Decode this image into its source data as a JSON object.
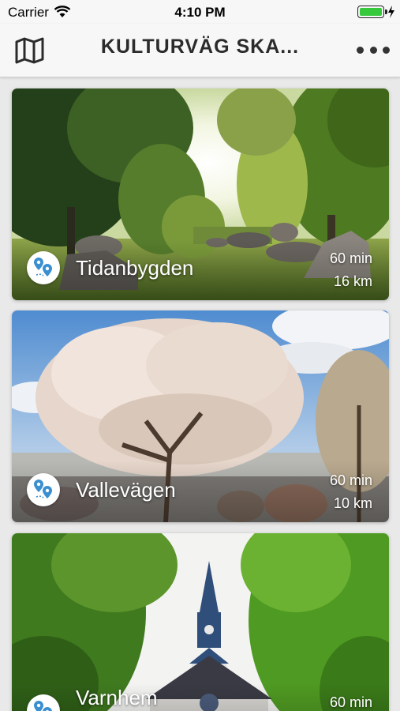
{
  "status_bar": {
    "carrier": "Carrier",
    "time": "4:10 PM",
    "battery_level": 1.0,
    "battery_color": "#36c93c"
  },
  "nav": {
    "title": "KULTURVÄG SKA...",
    "left_icon": "map-icon",
    "right_icon": "more-icon"
  },
  "routes": [
    {
      "name": "Tidanbygden",
      "duration": "60 min",
      "distance": "16 km"
    },
    {
      "name": "Vallevägen",
      "duration": "60 min",
      "distance": "10 km"
    },
    {
      "name": "Varnhem",
      "duration": "60 min",
      "distance": ""
    }
  ],
  "colors": {
    "pin_blue": "#3a8fd0",
    "nav_background": "#f7f7f7"
  }
}
